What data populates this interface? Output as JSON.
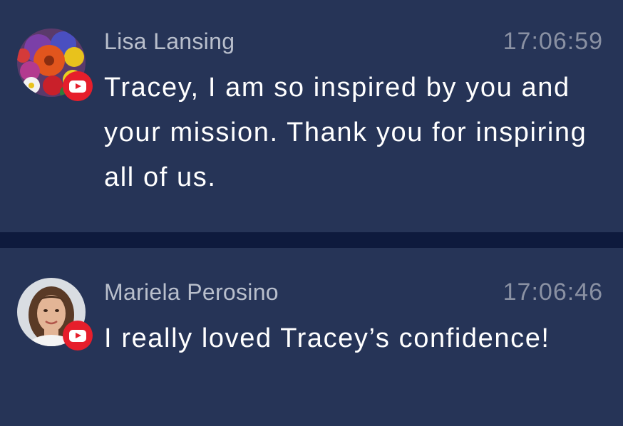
{
  "comments": [
    {
      "author": "Lisa Lansing",
      "timestamp": "17:06:59",
      "message": "Tracey, I am so inspired by you and your mission. Thank you for inspiring all of us.",
      "platform_icon": "youtube-icon",
      "avatar": "flower-bouquet-photo"
    },
    {
      "author": "Mariela Perosino",
      "timestamp": "17:06:46",
      "message": "I really loved Tracey’s confidence!",
      "platform_icon": "youtube-icon",
      "avatar": "woman-portrait-photo"
    }
  ],
  "colors": {
    "background": "#0e1a3d",
    "card": "#263457",
    "badge": "#e61e2b",
    "author_text": "#b9bfcc",
    "time_text": "#8a91a3",
    "message_text": "#ffffff"
  }
}
